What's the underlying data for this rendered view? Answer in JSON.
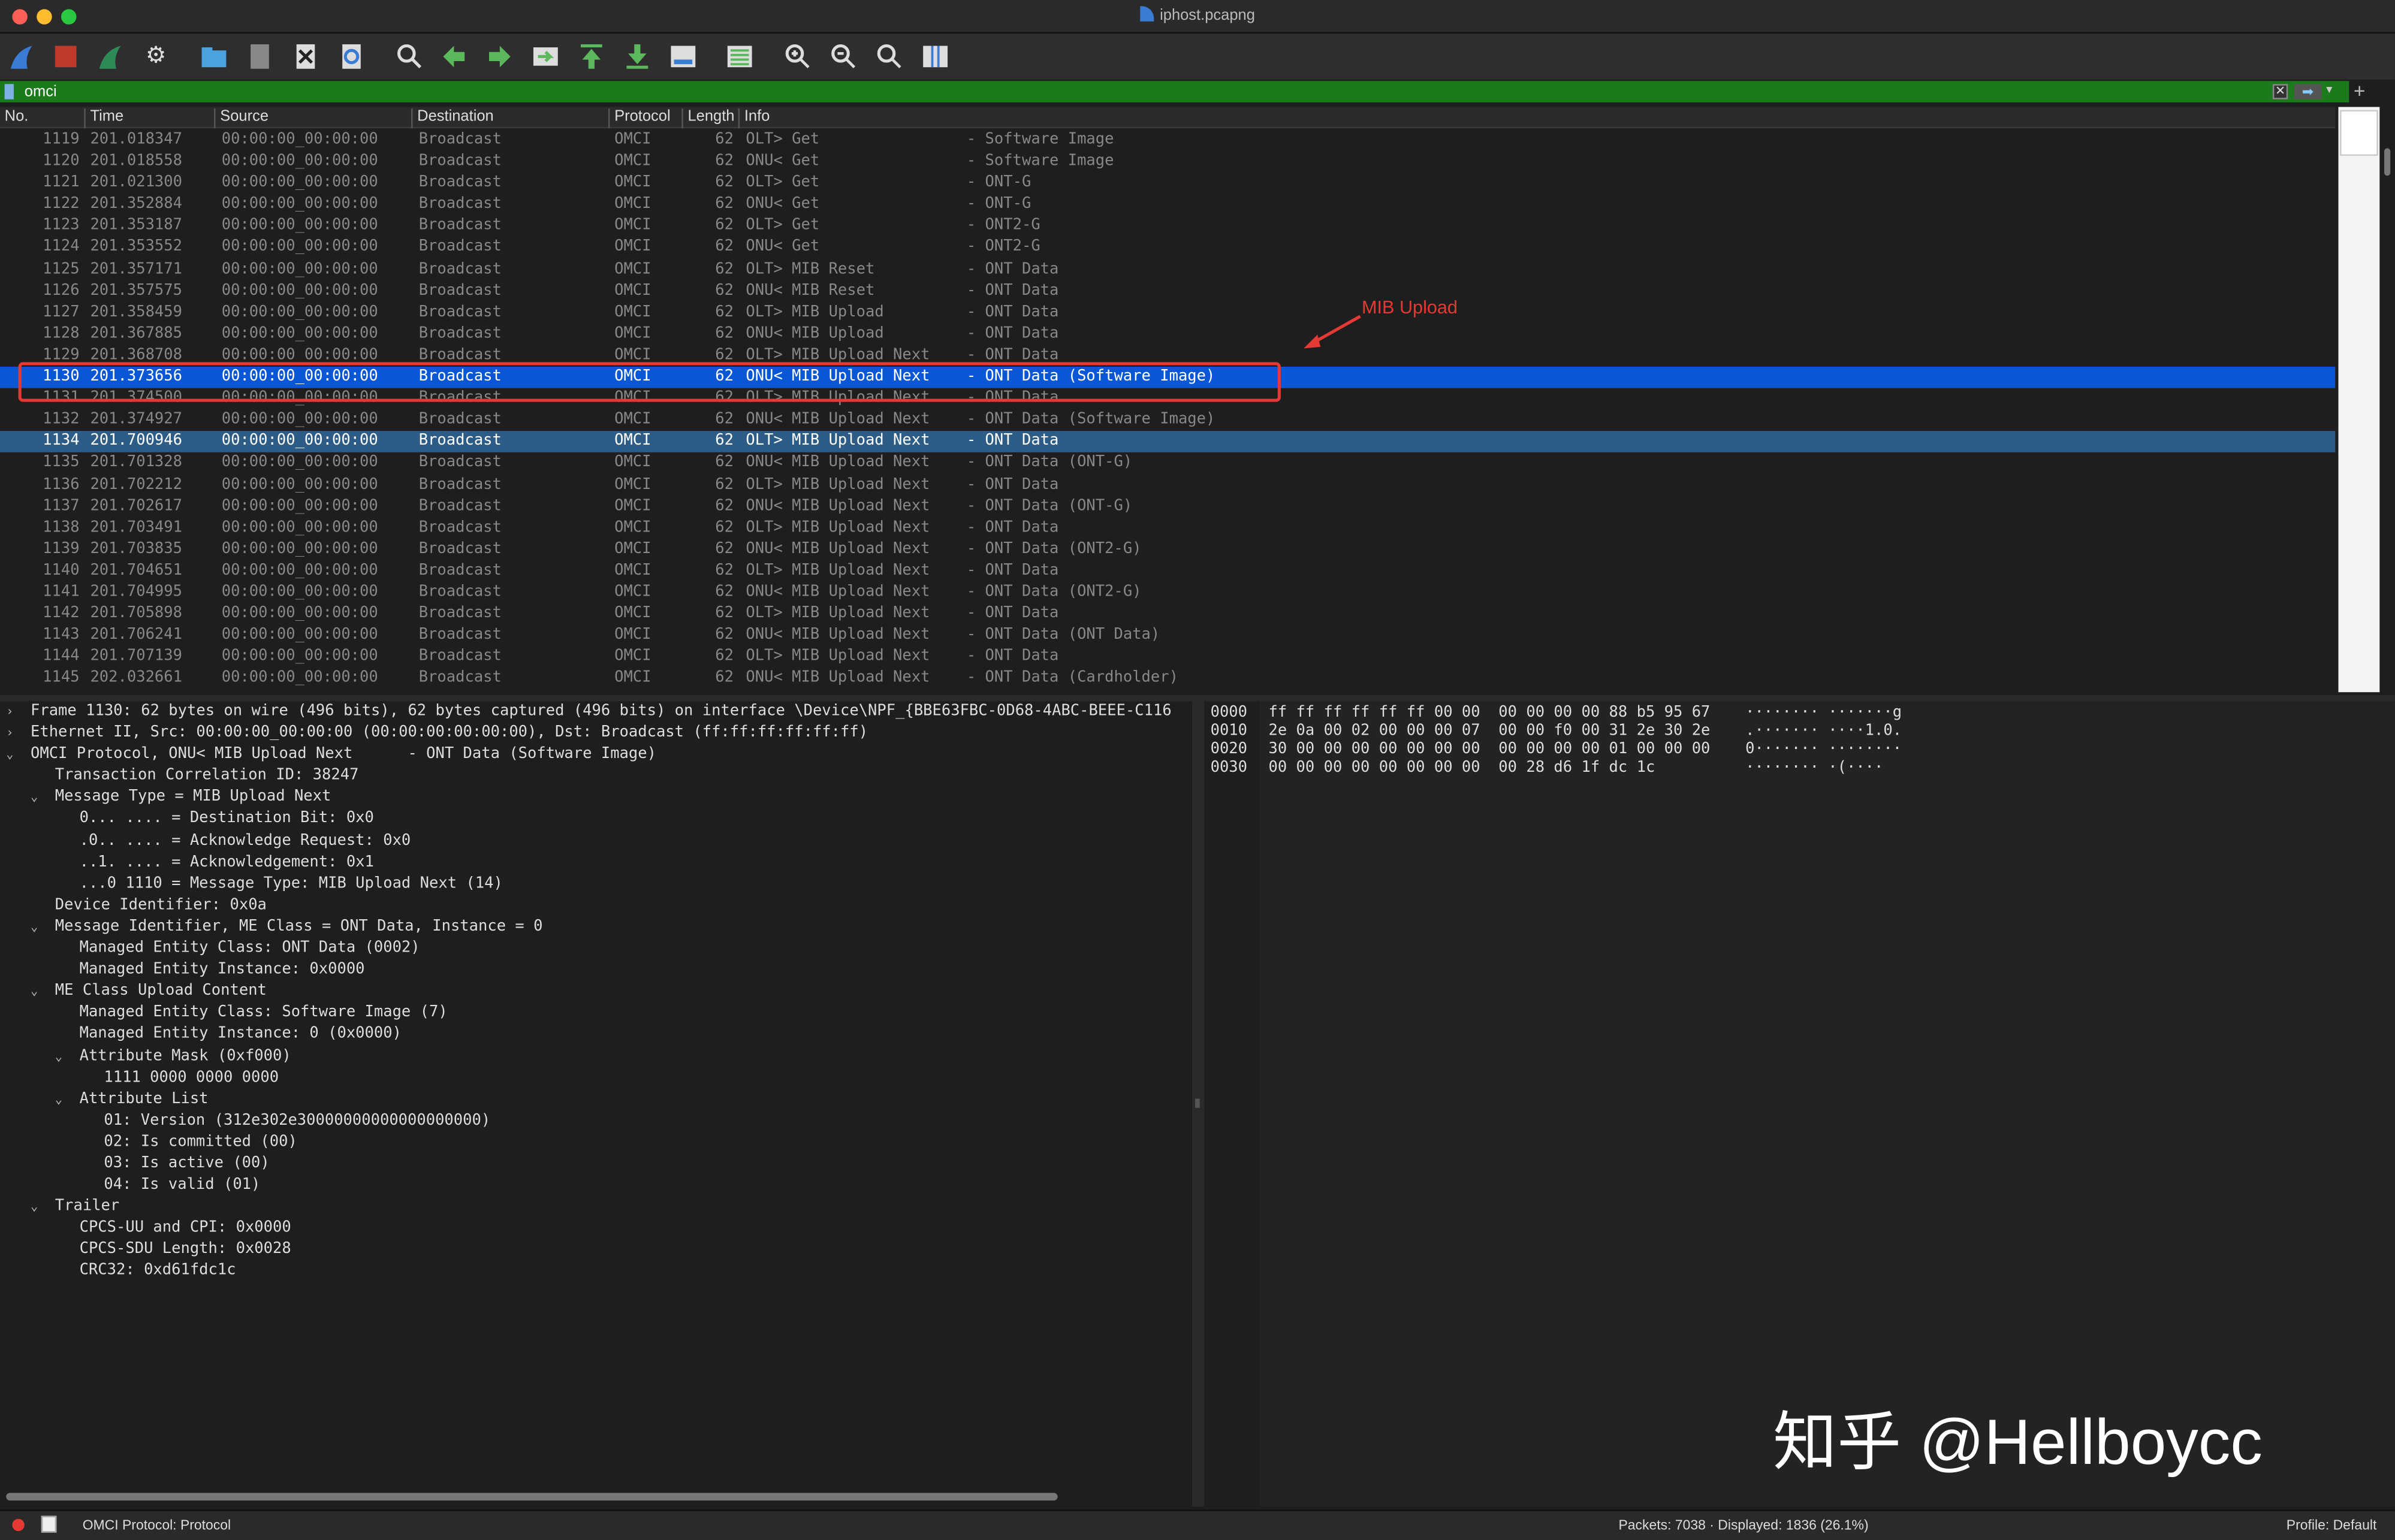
{
  "window": {
    "title": "iphost.pcapng"
  },
  "toolbar": {
    "icons": [
      "shark-fin-icon",
      "stop-icon",
      "restart-icon",
      "options-gear-icon",
      "open-folder-icon",
      "file-icon",
      "close-file-icon",
      "reload-icon",
      "find-icon",
      "go-back-icon",
      "go-forward-icon",
      "go-to-packet-icon",
      "first-packet-icon",
      "last-packet-icon",
      "autoscroll-icon",
      "colorize-icon",
      "zoom-in-icon",
      "zoom-out-icon",
      "zoom-reset-icon",
      "resize-columns-icon"
    ]
  },
  "filter": {
    "value": "omci"
  },
  "columns": {
    "no": "No.",
    "time": "Time",
    "source": "Source",
    "destination": "Destination",
    "protocol": "Protocol",
    "length": "Length",
    "info": "Info"
  },
  "packets": [
    {
      "no": "1119",
      "time": "201.018347",
      "src": "00:00:00_00:00:00",
      "dst": "Broadcast",
      "proto": "OMCI",
      "len": "62",
      "info": "OLT> Get                - Software Image"
    },
    {
      "no": "1120",
      "time": "201.018558",
      "src": "00:00:00_00:00:00",
      "dst": "Broadcast",
      "proto": "OMCI",
      "len": "62",
      "info": "ONU< Get                - Software Image"
    },
    {
      "no": "1121",
      "time": "201.021300",
      "src": "00:00:00_00:00:00",
      "dst": "Broadcast",
      "proto": "OMCI",
      "len": "62",
      "info": "OLT> Get                - ONT-G"
    },
    {
      "no": "1122",
      "time": "201.352884",
      "src": "00:00:00_00:00:00",
      "dst": "Broadcast",
      "proto": "OMCI",
      "len": "62",
      "info": "ONU< Get                - ONT-G"
    },
    {
      "no": "1123",
      "time": "201.353187",
      "src": "00:00:00_00:00:00",
      "dst": "Broadcast",
      "proto": "OMCI",
      "len": "62",
      "info": "OLT> Get                - ONT2-G"
    },
    {
      "no": "1124",
      "time": "201.353552",
      "src": "00:00:00_00:00:00",
      "dst": "Broadcast",
      "proto": "OMCI",
      "len": "62",
      "info": "ONU< Get                - ONT2-G"
    },
    {
      "no": "1125",
      "time": "201.357171",
      "src": "00:00:00_00:00:00",
      "dst": "Broadcast",
      "proto": "OMCI",
      "len": "62",
      "info": "OLT> MIB Reset          - ONT Data"
    },
    {
      "no": "1126",
      "time": "201.357575",
      "src": "00:00:00_00:00:00",
      "dst": "Broadcast",
      "proto": "OMCI",
      "len": "62",
      "info": "ONU< MIB Reset          - ONT Data"
    },
    {
      "no": "1127",
      "time": "201.358459",
      "src": "00:00:00_00:00:00",
      "dst": "Broadcast",
      "proto": "OMCI",
      "len": "62",
      "info": "OLT> MIB Upload         - ONT Data"
    },
    {
      "no": "1128",
      "time": "201.367885",
      "src": "00:00:00_00:00:00",
      "dst": "Broadcast",
      "proto": "OMCI",
      "len": "62",
      "info": "ONU< MIB Upload         - ONT Data"
    },
    {
      "no": "1129",
      "time": "201.368708",
      "src": "00:00:00_00:00:00",
      "dst": "Broadcast",
      "proto": "OMCI",
      "len": "62",
      "info": "OLT> MIB Upload Next    - ONT Data"
    },
    {
      "no": "1130",
      "time": "201.373656",
      "src": "00:00:00_00:00:00",
      "dst": "Broadcast",
      "proto": "OMCI",
      "len": "62",
      "info": "ONU< MIB Upload Next    - ONT Data (Software Image)",
      "state": "selected"
    },
    {
      "no": "1131",
      "time": "201.374500",
      "src": "00:00:00_00:00:00",
      "dst": "Broadcast",
      "proto": "OMCI",
      "len": "62",
      "info": "OLT> MIB Upload Next    - ONT Data"
    },
    {
      "no": "1132",
      "time": "201.374927",
      "src": "00:00:00_00:00:00",
      "dst": "Broadcast",
      "proto": "OMCI",
      "len": "62",
      "info": "ONU< MIB Upload Next    - ONT Data (Software Image)"
    },
    {
      "no": "1134",
      "time": "201.700946",
      "src": "00:00:00_00:00:00",
      "dst": "Broadcast",
      "proto": "OMCI",
      "len": "62",
      "info": "OLT> MIB Upload Next    - ONT Data",
      "state": "marked"
    },
    {
      "no": "1135",
      "time": "201.701328",
      "src": "00:00:00_00:00:00",
      "dst": "Broadcast",
      "proto": "OMCI",
      "len": "62",
      "info": "ONU< MIB Upload Next    - ONT Data (ONT-G)"
    },
    {
      "no": "1136",
      "time": "201.702212",
      "src": "00:00:00_00:00:00",
      "dst": "Broadcast",
      "proto": "OMCI",
      "len": "62",
      "info": "OLT> MIB Upload Next    - ONT Data"
    },
    {
      "no": "1137",
      "time": "201.702617",
      "src": "00:00:00_00:00:00",
      "dst": "Broadcast",
      "proto": "OMCI",
      "len": "62",
      "info": "ONU< MIB Upload Next    - ONT Data (ONT-G)"
    },
    {
      "no": "1138",
      "time": "201.703491",
      "src": "00:00:00_00:00:00",
      "dst": "Broadcast",
      "proto": "OMCI",
      "len": "62",
      "info": "OLT> MIB Upload Next    - ONT Data"
    },
    {
      "no": "1139",
      "time": "201.703835",
      "src": "00:00:00_00:00:00",
      "dst": "Broadcast",
      "proto": "OMCI",
      "len": "62",
      "info": "ONU< MIB Upload Next    - ONT Data (ONT2-G)"
    },
    {
      "no": "1140",
      "time": "201.704651",
      "src": "00:00:00_00:00:00",
      "dst": "Broadcast",
      "proto": "OMCI",
      "len": "62",
      "info": "OLT> MIB Upload Next    - ONT Data"
    },
    {
      "no": "1141",
      "time": "201.704995",
      "src": "00:00:00_00:00:00",
      "dst": "Broadcast",
      "proto": "OMCI",
      "len": "62",
      "info": "ONU< MIB Upload Next    - ONT Data (ONT2-G)"
    },
    {
      "no": "1142",
      "time": "201.705898",
      "src": "00:00:00_00:00:00",
      "dst": "Broadcast",
      "proto": "OMCI",
      "len": "62",
      "info": "OLT> MIB Upload Next    - ONT Data"
    },
    {
      "no": "1143",
      "time": "201.706241",
      "src": "00:00:00_00:00:00",
      "dst": "Broadcast",
      "proto": "OMCI",
      "len": "62",
      "info": "ONU< MIB Upload Next    - ONT Data (ONT Data)"
    },
    {
      "no": "1144",
      "time": "201.707139",
      "src": "00:00:00_00:00:00",
      "dst": "Broadcast",
      "proto": "OMCI",
      "len": "62",
      "info": "OLT> MIB Upload Next    - ONT Data"
    },
    {
      "no": "1145",
      "time": "202.032661",
      "src": "00:00:00_00:00:00",
      "dst": "Broadcast",
      "proto": "OMCI",
      "len": "62",
      "info": "ONU< MIB Upload Next    - ONT Data (Cardholder)"
    }
  ],
  "annotation": {
    "label": "MIB Upload",
    "color": "#e53935"
  },
  "details": [
    {
      "lvl": 0,
      "arrow": "right",
      "text": "Frame 1130: 62 bytes on wire (496 bits), 62 bytes captured (496 bits) on interface \\Device\\NPF_{BBE63FBC-0D68-4ABC-BEEE-C116"
    },
    {
      "lvl": 0,
      "arrow": "right",
      "text": "Ethernet II, Src: 00:00:00_00:00:00 (00:00:00:00:00:00), Dst: Broadcast (ff:ff:ff:ff:ff:ff)"
    },
    {
      "lvl": 0,
      "arrow": "down",
      "text": "OMCI Protocol, ONU< MIB Upload Next      - ONT Data (Software Image)"
    },
    {
      "lvl": 1,
      "arrow": "",
      "text": "Transaction Correlation ID: 38247"
    },
    {
      "lvl": 1,
      "arrow": "down",
      "text": "Message Type = MIB Upload Next"
    },
    {
      "lvl": 2,
      "arrow": "",
      "text": "0... .... = Destination Bit: 0x0"
    },
    {
      "lvl": 2,
      "arrow": "",
      "text": ".0.. .... = Acknowledge Request: 0x0"
    },
    {
      "lvl": 2,
      "arrow": "",
      "text": "..1. .... = Acknowledgement: 0x1"
    },
    {
      "lvl": 2,
      "arrow": "",
      "text": "...0 1110 = Message Type: MIB Upload Next (14)"
    },
    {
      "lvl": 1,
      "arrow": "",
      "text": "Device Identifier: 0x0a"
    },
    {
      "lvl": 1,
      "arrow": "down",
      "text": "Message Identifier, ME Class = ONT Data, Instance = 0"
    },
    {
      "lvl": 2,
      "arrow": "",
      "text": "Managed Entity Class: ONT Data (0002)"
    },
    {
      "lvl": 2,
      "arrow": "",
      "text": "Managed Entity Instance: 0x0000"
    },
    {
      "lvl": 1,
      "arrow": "down",
      "text": "ME Class Upload Content"
    },
    {
      "lvl": 2,
      "arrow": "",
      "text": "Managed Entity Class: Software Image (7)"
    },
    {
      "lvl": 2,
      "arrow": "",
      "text": "Managed Entity Instance: 0 (0x0000)"
    },
    {
      "lvl": 2,
      "arrow": "down",
      "text": "Attribute Mask (0xf000)"
    },
    {
      "lvl": 3,
      "arrow": "",
      "text": "1111 0000 0000 0000"
    },
    {
      "lvl": 2,
      "arrow": "down",
      "text": "Attribute List"
    },
    {
      "lvl": 3,
      "arrow": "",
      "text": "01: Version (312e302e30000000000000000000)"
    },
    {
      "lvl": 3,
      "arrow": "",
      "text": "02: Is committed (00)"
    },
    {
      "lvl": 3,
      "arrow": "",
      "text": "03: Is active (00)"
    },
    {
      "lvl": 3,
      "arrow": "",
      "text": "04: Is valid (01)"
    },
    {
      "lvl": 1,
      "arrow": "down",
      "text": "Trailer"
    },
    {
      "lvl": 2,
      "arrow": "",
      "text": "CPCS-UU and CPI: 0x0000"
    },
    {
      "lvl": 2,
      "arrow": "",
      "text": "CPCS-SDU Length: 0x0028"
    },
    {
      "lvl": 2,
      "arrow": "",
      "text": "CRC32: 0xd61fdc1c"
    }
  ],
  "hex": [
    {
      "offset": "0000",
      "bytes": "ff ff ff ff ff ff 00 00  00 00 00 00 88 b5 95 67",
      "ascii": "········ ·······g"
    },
    {
      "offset": "0010",
      "bytes": "2e 0a 00 02 00 00 00 07  00 00 f0 00 31 2e 30 2e",
      "ascii": ".······· ····1.0."
    },
    {
      "offset": "0020",
      "bytes": "30 00 00 00 00 00 00 00  00 00 00 00 01 00 00 00",
      "ascii": "0······· ········"
    },
    {
      "offset": "0030",
      "bytes": "00 00 00 00 00 00 00 00  00 28 d6 1f dc 1c",
      "ascii": "········ ·(····"
    }
  ],
  "watermark": "知乎 @Hellboycc",
  "status": {
    "protocol": "OMCI Protocol: Protocol",
    "packets": "Packets: 7038 · Displayed: 1836 (26.1%)",
    "profile": "Profile: Default"
  }
}
